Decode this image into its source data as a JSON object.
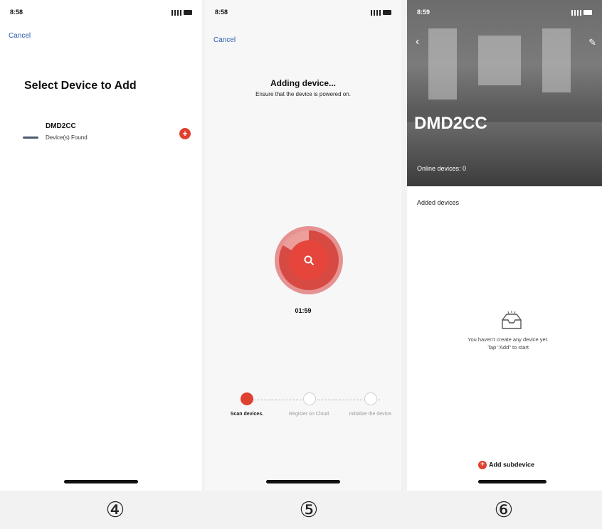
{
  "screen1": {
    "status_time": "8:58",
    "cancel": "Cancel",
    "title": "Select Device to Add",
    "device": {
      "name": "DMD2CC",
      "status": "Device(s) Found",
      "add_icon": "plus-icon"
    }
  },
  "screen2": {
    "status_time": "8:58",
    "cancel": "Cancel",
    "title": "Adding device...",
    "subtitle": "Ensure that the device is powered on.",
    "timer": "01:59",
    "steps": [
      {
        "label": "Scan devices.",
        "state": "active"
      },
      {
        "label": "Register on Cloud.",
        "state": "idle"
      },
      {
        "label": "Initialize the device.",
        "state": "idle"
      }
    ]
  },
  "screen3": {
    "status_time": "8:59",
    "home_name": "DMD2CC",
    "online_devices": "Online devices: 0",
    "section_label": "Added devices",
    "empty_text_line1": "You haven't create any device yet.",
    "empty_text_line2": "Tap \"Add\" to start",
    "add_subdevice": "Add subdevice"
  },
  "labels": {
    "step4": "④",
    "step5": "⑤",
    "step6": "⑥"
  },
  "colors": {
    "accent": "#e0402f",
    "link": "#2a5db0"
  }
}
